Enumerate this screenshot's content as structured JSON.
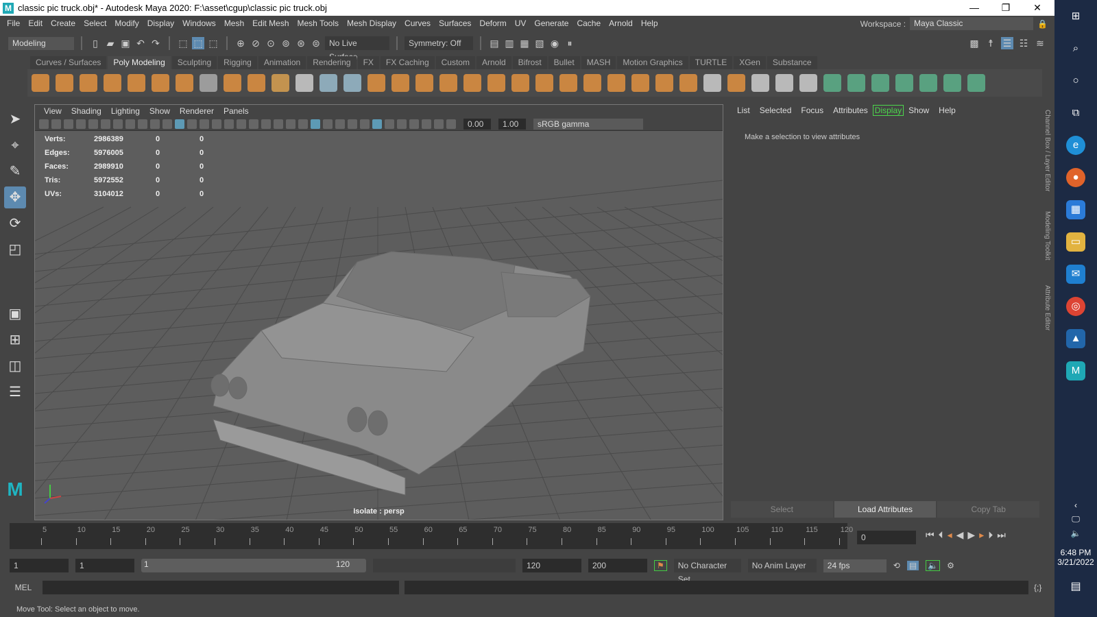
{
  "window": {
    "title": "classic pic truck.obj* - Autodesk Maya 2020: F:\\asset\\cgup\\classic pic truck.obj",
    "logo": "M",
    "minimize": "—",
    "restore": "❐",
    "close": "✕"
  },
  "menu": [
    "File",
    "Edit",
    "Create",
    "Select",
    "Modify",
    "Display",
    "Windows",
    "Mesh",
    "Edit Mesh",
    "Mesh Tools",
    "Mesh Display",
    "Curves",
    "Surfaces",
    "Deform",
    "UV",
    "Generate",
    "Cache",
    "Arnold",
    "Help"
  ],
  "workspace": {
    "label": "Workspace :",
    "value": "Maya Classic"
  },
  "status": {
    "menuset": "Modeling",
    "live_surface": "No Live Surface",
    "symmetry": "Symmetry: Off"
  },
  "shelf_tabs": [
    "Curves / Surfaces",
    "Poly Modeling",
    "Sculpting",
    "Rigging",
    "Animation",
    "Rendering",
    "FX",
    "FX Caching",
    "Custom",
    "Arnold",
    "Bifrost",
    "Bullet",
    "MASH",
    "Motion Graphics",
    "TURTLE",
    "XGen",
    "Substance"
  ],
  "shelf_active": "Poly Modeling",
  "viewport": {
    "menu": [
      "View",
      "Shading",
      "Lighting",
      "Show",
      "Renderer",
      "Panels"
    ],
    "near": "0.00",
    "gamma_val": "1.00",
    "colorspace": "sRGB gamma",
    "camera_label": "Isolate : persp",
    "hud": [
      {
        "label": "Verts:",
        "value": "2986389",
        "a": "0",
        "b": "0"
      },
      {
        "label": "Edges:",
        "value": "5976005",
        "a": "0",
        "b": "0"
      },
      {
        "label": "Faces:",
        "value": "2989910",
        "a": "0",
        "b": "0"
      },
      {
        "label": "Tris:",
        "value": "5972552",
        "a": "0",
        "b": "0"
      },
      {
        "label": "UVs:",
        "value": "3104012",
        "a": "0",
        "b": "0"
      }
    ]
  },
  "channel_box": {
    "menu": [
      "List",
      "Selected",
      "Focus",
      "Attributes",
      "Display",
      "Show",
      "Help"
    ],
    "active": "Display",
    "message": "Make a selection to view attributes",
    "buttons": [
      "Select",
      "Load Attributes",
      "Copy Tab"
    ]
  },
  "side_tabs": [
    "Channel Box / Layer Editor",
    "Modeling Toolkit",
    "Attribute Editor"
  ],
  "timeline": {
    "ticks": [
      "5",
      "10",
      "15",
      "20",
      "25",
      "30",
      "35",
      "40",
      "45",
      "50",
      "55",
      "60",
      "65",
      "70",
      "75",
      "80",
      "85",
      "90",
      "95",
      "100",
      "105",
      "110",
      "115",
      "120"
    ],
    "current_frame": "0"
  },
  "range": {
    "start": "1",
    "anim_start": "1",
    "slider_start": "1",
    "slider_end": "120",
    "anim_end": "120",
    "end": "200",
    "character_set": "No Character Set",
    "anim_layer": "No Anim Layer",
    "fps": "24 fps"
  },
  "command": {
    "label": "MEL"
  },
  "help_line": "Move Tool: Select an object to move.",
  "taskbar": {
    "time": "6:48 PM",
    "date": "3/21/2022"
  }
}
